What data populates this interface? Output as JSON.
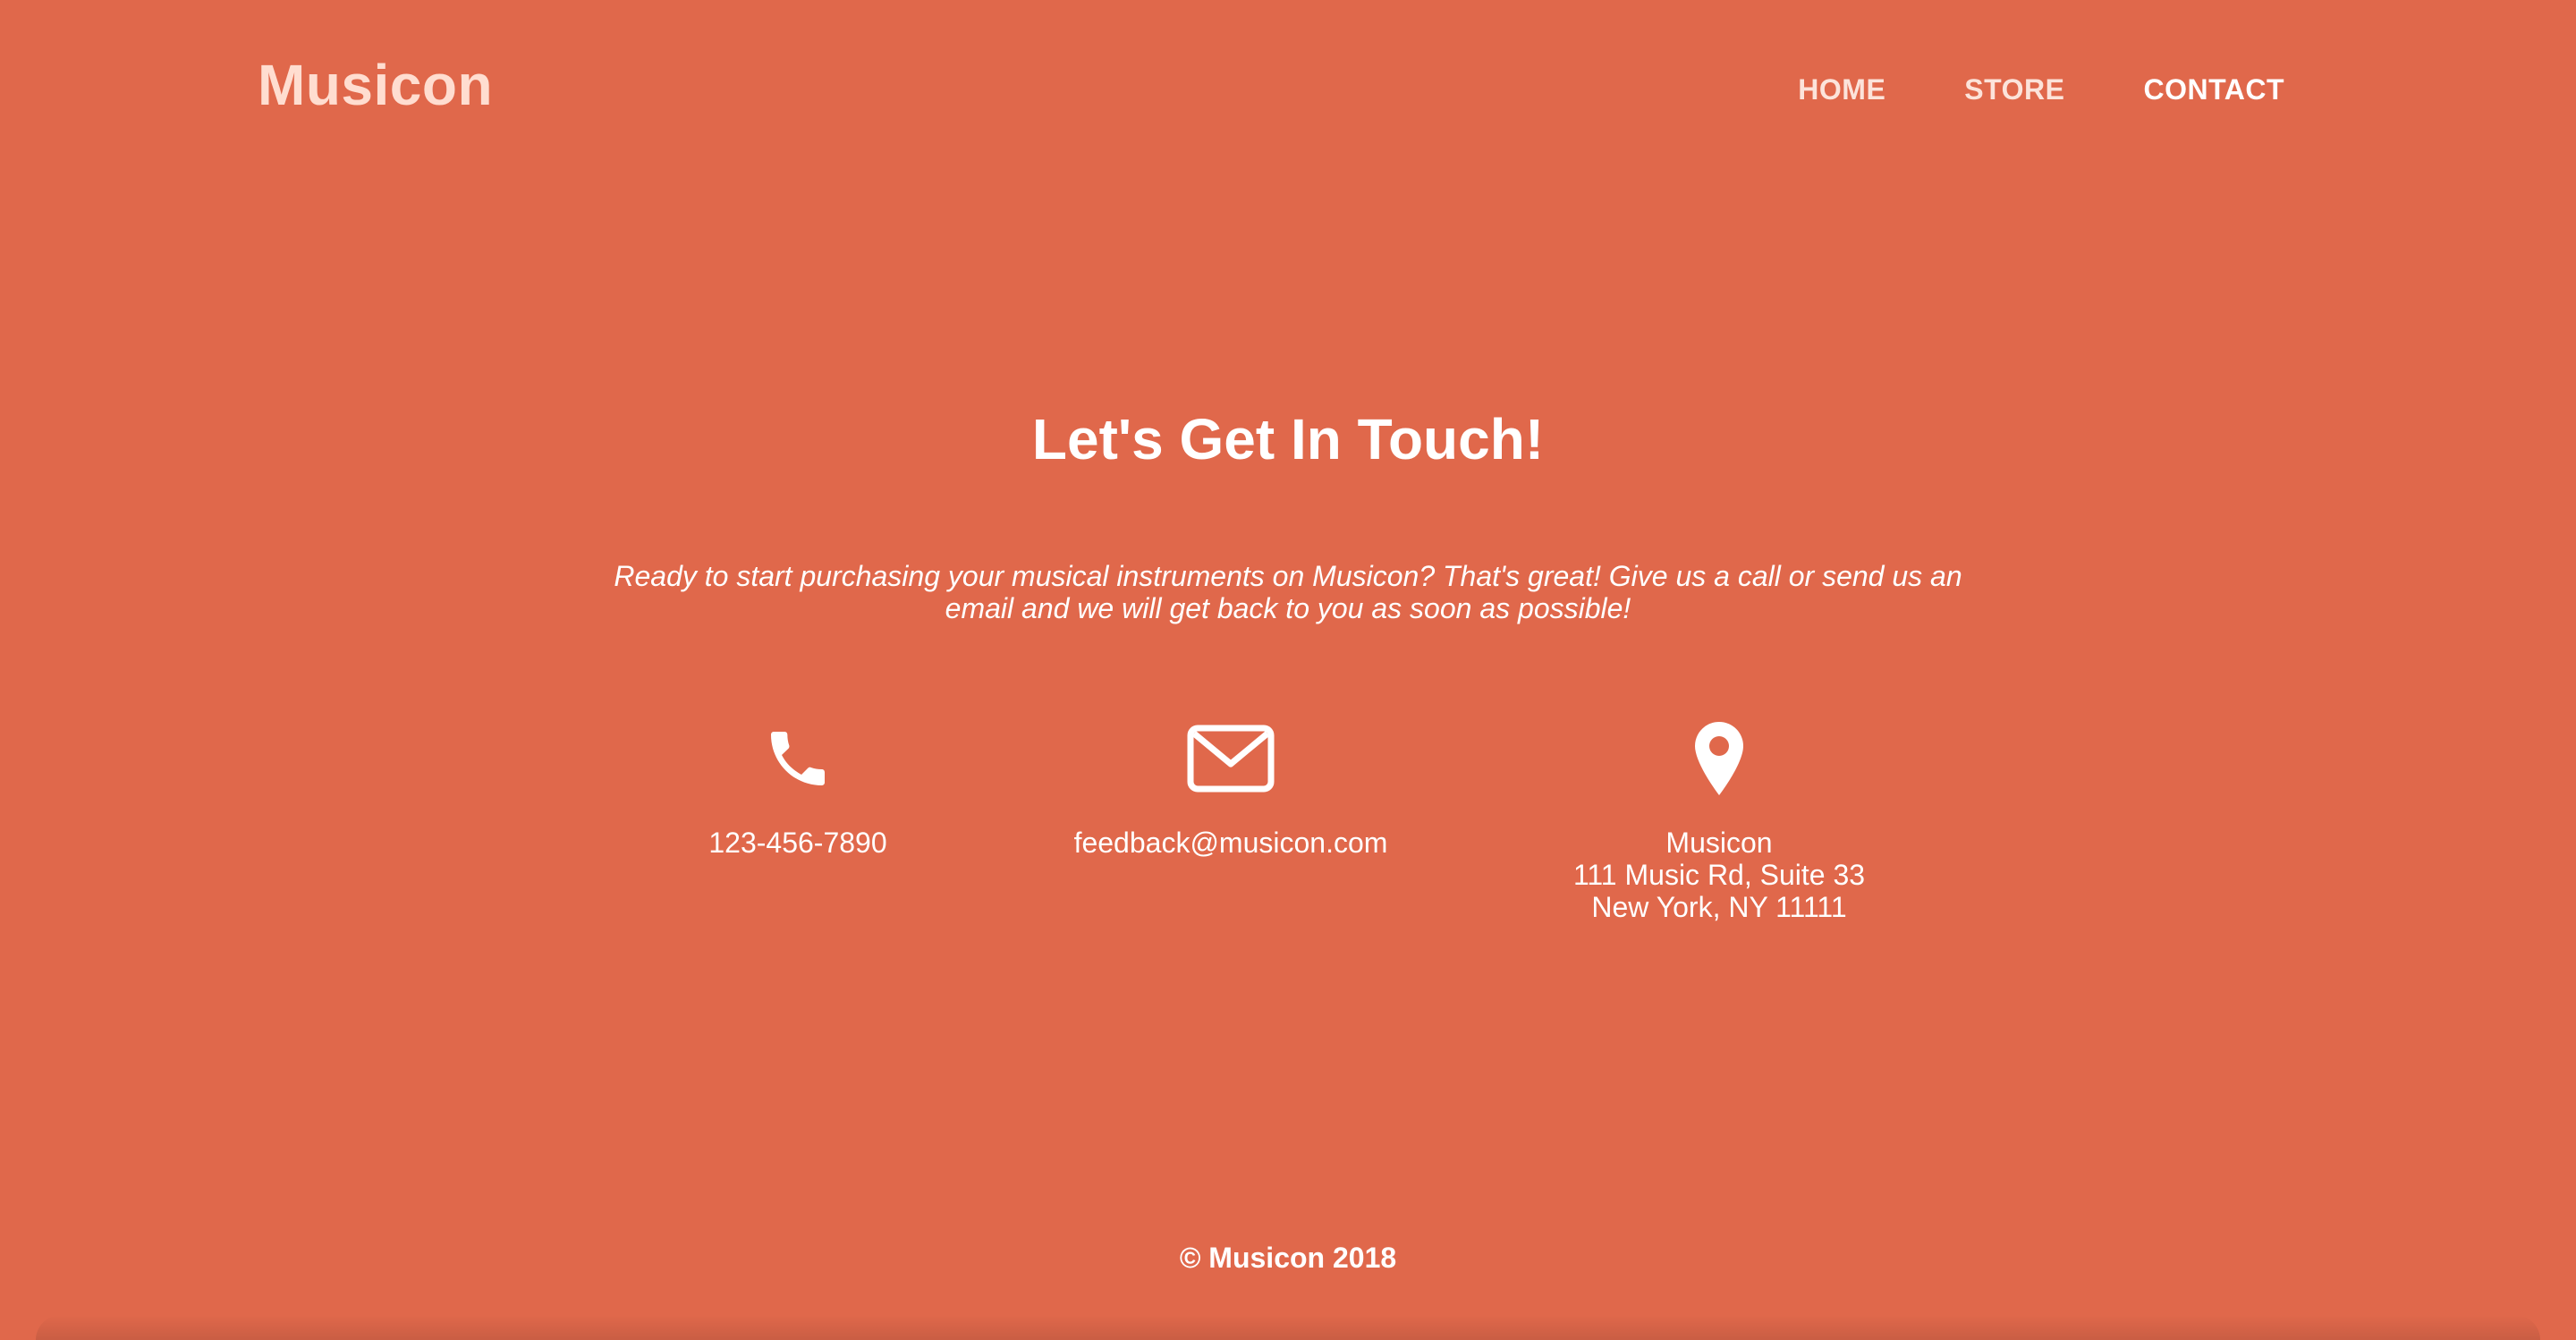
{
  "header": {
    "brand": "Musicon",
    "nav": [
      {
        "label": "HOME",
        "active": false
      },
      {
        "label": "STORE",
        "active": false
      },
      {
        "label": "CONTACT",
        "active": true
      }
    ]
  },
  "main": {
    "heading": "Let's Get In Touch!",
    "intro": "Ready to start purchasing your musical instruments on Musicon? That's great! Give us a call or send us an email and we will get back to you as soon as possible!",
    "contacts": {
      "phone": {
        "icon": "phone-icon",
        "text": "123-456-7890"
      },
      "email": {
        "icon": "envelope-icon",
        "text": "feedback@musicon.com"
      },
      "address": {
        "icon": "map-pin-icon",
        "line1": "Musicon",
        "line2": "111 Music Rd, Suite 33",
        "line3": "New York, NY 11111"
      }
    }
  },
  "footer": {
    "copyright": "© Musicon 2018"
  },
  "colors": {
    "background": "#E0684B",
    "brand": "#FFDDD0",
    "text": "#FFFFFF"
  }
}
